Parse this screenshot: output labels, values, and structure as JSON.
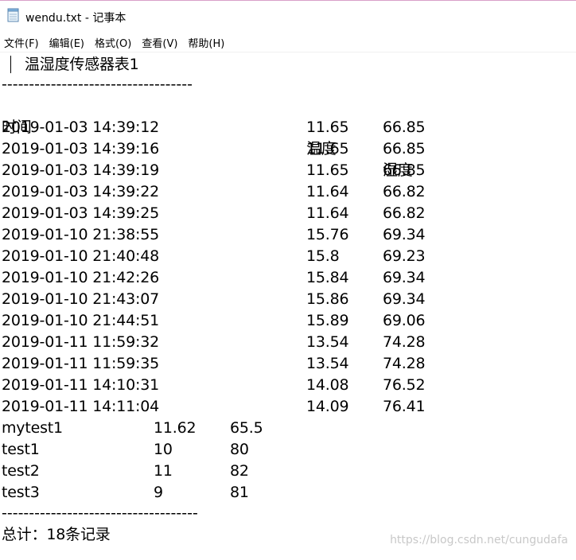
{
  "window": {
    "title": "wendu.txt - 记事本"
  },
  "menu": [
    {
      "label": "文件(F)"
    },
    {
      "label": "编辑(E)"
    },
    {
      "label": "格式(O)"
    },
    {
      "label": "查看(V)"
    },
    {
      "label": "帮助(H)"
    }
  ],
  "document": {
    "heading": "温湿度传感器表1",
    "separator_top": "-----------------------------------",
    "header": {
      "time": "时间",
      "temp": "温度",
      "humidity": "湿度"
    },
    "rows": [
      {
        "time": "2019-01-03 14:39:12",
        "temp": "11.65",
        "humidity": "66.85"
      },
      {
        "time": "2019-01-03 14:39:16",
        "temp": "11.65",
        "humidity": "66.85"
      },
      {
        "time": "2019-01-03 14:39:19",
        "temp": "11.65",
        "humidity": "66.85"
      },
      {
        "time": "2019-01-03 14:39:22",
        "temp": "11.64",
        "humidity": "66.82"
      },
      {
        "time": "2019-01-03 14:39:25",
        "temp": "11.64",
        "humidity": "66.82"
      },
      {
        "time": "2019-01-10 21:38:55",
        "temp": "15.76",
        "humidity": "69.34"
      },
      {
        "time": "2019-01-10 21:40:48",
        "temp": "15.8",
        "humidity": "69.23"
      },
      {
        "time": "2019-01-10 21:42:26",
        "temp": "15.84",
        "humidity": "69.34"
      },
      {
        "time": "2019-01-10 21:43:07",
        "temp": "15.86",
        "humidity": "69.34"
      },
      {
        "time": "2019-01-10 21:44:51",
        "temp": "15.89",
        "humidity": "69.06"
      },
      {
        "time": "2019-01-11 11:59:32",
        "temp": "13.54",
        "humidity": "74.28"
      },
      {
        "time": "2019-01-11 11:59:35",
        "temp": "13.54",
        "humidity": "74.28"
      },
      {
        "time": "2019-01-11 14:10:31",
        "temp": "14.08",
        "humidity": "76.52"
      },
      {
        "time": "2019-01-11 14:11:04",
        "temp": "14.09",
        "humidity": "76.41"
      }
    ],
    "test_rows": [
      {
        "name": "mytest1",
        "temp": "11.62",
        "humidity": "65.5"
      },
      {
        "name": "test1",
        "temp": "10",
        "humidity": "80"
      },
      {
        "name": "test2",
        "temp": "11",
        "humidity": "82"
      },
      {
        "name": "test3",
        "temp": "9",
        "humidity": "81"
      }
    ],
    "separator_bottom": "------------------------------------",
    "total": "总计：18条记录"
  },
  "watermark": "https://blog.csdn.net/cungudafa"
}
